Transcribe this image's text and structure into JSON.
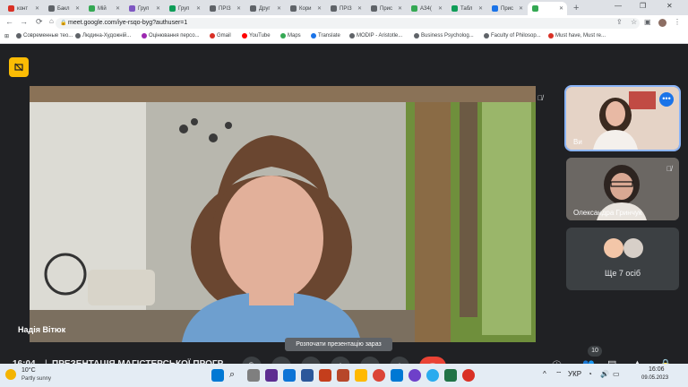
{
  "browser": {
    "tabs": [
      {
        "label": "конт",
        "color": "#d93025"
      },
      {
        "label": "Бакл",
        "color": "#5f6368"
      },
      {
        "label": "Мій",
        "color": "#34a853"
      },
      {
        "label": "Груп",
        "color": "#7e57c2"
      },
      {
        "label": "Груп",
        "color": "#0f9d58"
      },
      {
        "label": "ПРІЗ",
        "color": "#5f6368"
      },
      {
        "label": "Друг",
        "color": "#5f6368"
      },
      {
        "label": "Кори",
        "color": "#5f6368"
      },
      {
        "label": "ПРІЗ",
        "color": "#5f6368"
      },
      {
        "label": "Прис",
        "color": "#5f6368"
      },
      {
        "label": "АЗ4(",
        "color": "#34a853"
      },
      {
        "label": "Табл",
        "color": "#0f9d58"
      },
      {
        "label": "Прис",
        "color": "#1a73e8"
      },
      {
        "label": "",
        "color": "#34a853"
      }
    ],
    "new_tab": "+",
    "url": "meet.google.com/iye-rsqo-byg?authuser=1",
    "bookmarks": [
      {
        "label": "Современные тео...",
        "color": "#5f6368"
      },
      {
        "label": "Людина-Художній...",
        "color": "#5f6368"
      },
      {
        "label": "Оцінювання персо...",
        "color": "#9c27b0"
      },
      {
        "label": "Gmail",
        "color": "#d93025"
      },
      {
        "label": "YouTube",
        "color": "#ff0000"
      },
      {
        "label": "Maps",
        "color": "#34a853"
      },
      {
        "label": "Translate",
        "color": "#1a73e8"
      },
      {
        "label": "MODIP - Aristotle...",
        "color": "#5f6368"
      },
      {
        "label": "Business Psycholog...",
        "color": "#5f6368"
      },
      {
        "label": "Faculty of Philosop...",
        "color": "#5f6368"
      },
      {
        "label": "Must have, Must re...",
        "color": "#d93025"
      }
    ]
  },
  "meet": {
    "main_speaker": "Надія Вітюк",
    "participants": [
      {
        "name": "Ви"
      },
      {
        "name": "Олександра Гринчук"
      },
      {
        "name": "Ще 7 осіб"
      }
    ],
    "tooltip": "Розпочати презентацію зараз",
    "time": "16:04",
    "meeting_title": "ПРЕЗЕНТАЦІЯ МАГІСТЕРСЬКОЇ ПРОГР...",
    "participants_badge": "10"
  },
  "taskbar": {
    "weather_temp": "10°C",
    "weather_desc": "Partly sunny",
    "lang": "УКР",
    "clock_time": "16:06",
    "clock_date": "09.05.2023"
  }
}
